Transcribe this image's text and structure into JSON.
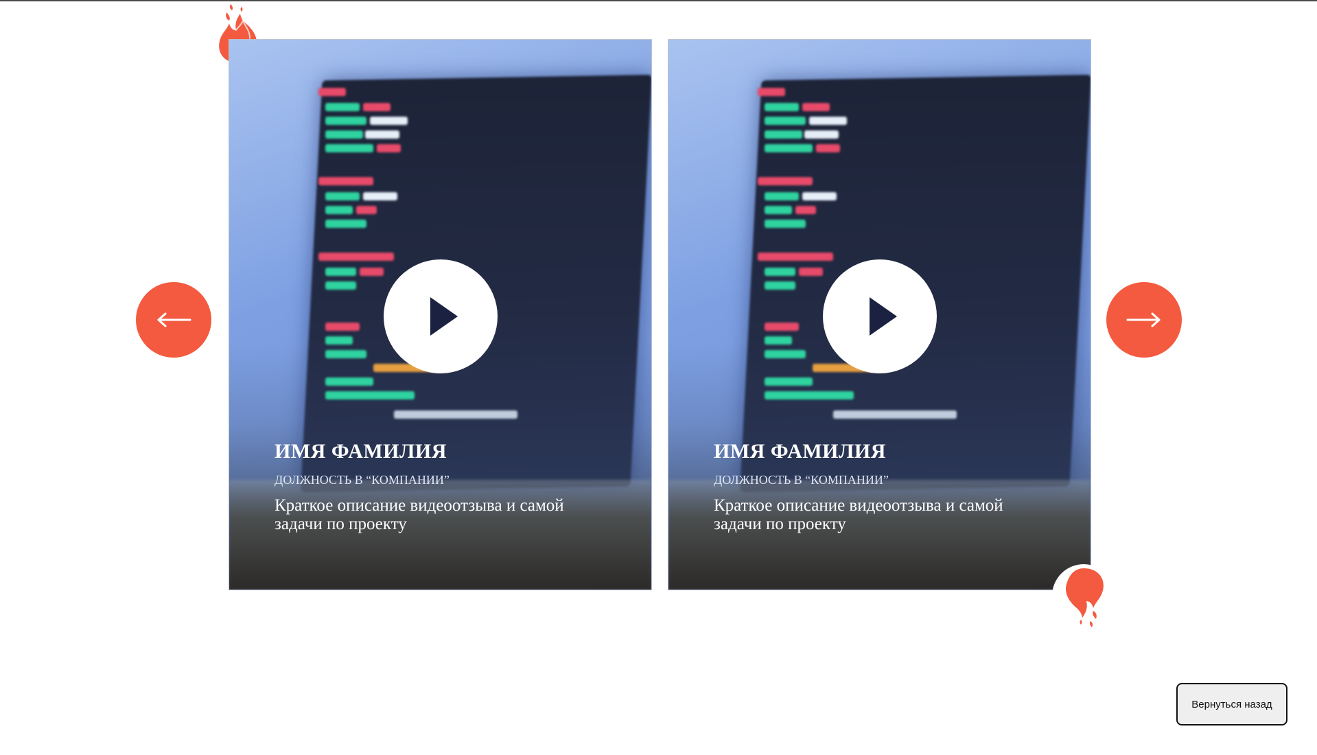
{
  "carousel": {
    "accent_color": "#f45a3f",
    "prev_icon": "arrow-left-icon",
    "next_icon": "arrow-right-icon",
    "decoration_icon": "fire-icon",
    "play_icon": "play-icon",
    "cards": [
      {
        "name": "ИМЯ ФАМИЛИЯ",
        "position": "ДОЛЖНОСТЬ В “КОМПАНИИ”",
        "description": "Краткое описание видеоотзыва и самой задачи по проекту"
      },
      {
        "name": "ИМЯ ФАМИЛИЯ",
        "position": "ДОЛЖНОСТЬ В “КОМПАНИИ”",
        "description": "Краткое описание видеоотзыва и самой задачи по проекту"
      }
    ]
  },
  "back_button": {
    "label": "Вернуться назад"
  }
}
